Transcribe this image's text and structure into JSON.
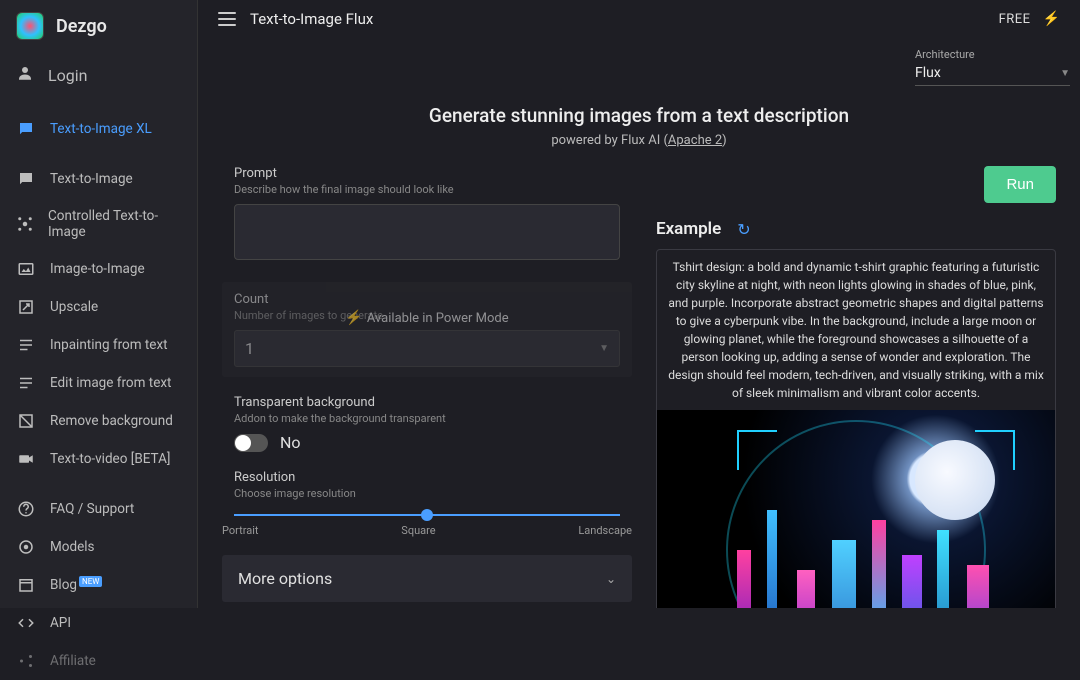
{
  "brand": "Dezgo",
  "login": "Login",
  "sidebar": {
    "items": [
      {
        "label": "Text-to-Image XL",
        "active": true
      },
      {
        "label": "Text-to-Image"
      },
      {
        "label": "Controlled Text-to-Image"
      },
      {
        "label": "Image-to-Image"
      },
      {
        "label": "Upscale"
      },
      {
        "label": "Inpainting from text"
      },
      {
        "label": "Edit image from text"
      },
      {
        "label": "Remove background"
      },
      {
        "label": "Text-to-video [BETA]"
      }
    ],
    "footer": [
      {
        "label": "FAQ / Support"
      },
      {
        "label": "Models"
      },
      {
        "label": "Blog",
        "badge": "NEW"
      },
      {
        "label": "API"
      },
      {
        "label": "Affiliate"
      }
    ]
  },
  "topbar": {
    "title": "Text-to-Image Flux",
    "plan": "FREE"
  },
  "architecture": {
    "label": "Architecture",
    "value": "Flux"
  },
  "hero": {
    "title": "Generate stunning images from a text description",
    "sub_prefix": "powered by Flux AI (",
    "license": "Apache 2",
    "sub_suffix": ")"
  },
  "prompt": {
    "label": "Prompt",
    "hint": "Describe how the final image should look like",
    "value": ""
  },
  "count": {
    "label": "Count",
    "hint": "Number of images to generate",
    "value": "1",
    "overlay": "Available in Power Mode"
  },
  "transparent": {
    "label": "Transparent background",
    "hint": "Addon to make the background transparent",
    "state": "No"
  },
  "resolution": {
    "label": "Resolution",
    "hint": "Choose image resolution",
    "ticks": [
      "Portrait",
      "Square",
      "Landscape"
    ]
  },
  "more": "More options",
  "run": "Run",
  "example": {
    "title": "Example",
    "text": "Tshirt design: a bold and dynamic t-shirt graphic featuring a futuristic city skyline at night, with neon lights glowing in shades of blue, pink, and purple. Incorporate abstract geometric shapes and digital patterns to give a cyberpunk vibe. In the background, include a large moon or glowing planet, while the foreground showcases a silhouette of a person looking up, adding a sense of wonder and exploration. The design should feel modern, tech-driven, and visually striking, with a mix of sleek minimalism and vibrant color accents."
  }
}
